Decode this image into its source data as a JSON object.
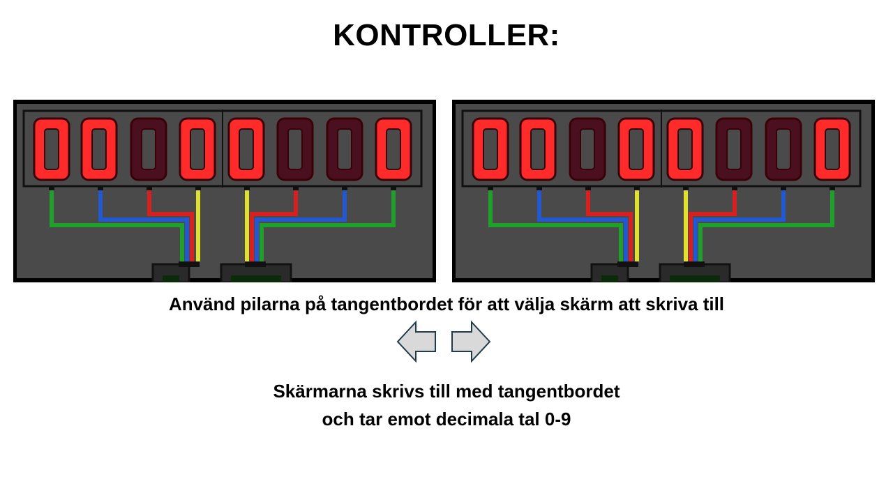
{
  "title": "KONTROLLER:",
  "displays": [
    {
      "digits": [
        "0",
        "0",
        "0",
        "0",
        "0",
        "0",
        "0",
        "0"
      ],
      "lit": [
        true,
        true,
        false,
        true,
        true,
        false,
        false,
        true
      ]
    },
    {
      "digits": [
        "0",
        "0",
        "0",
        "0",
        "0",
        "0",
        "0",
        "0"
      ],
      "lit": [
        true,
        true,
        false,
        true,
        true,
        false,
        false,
        true
      ]
    }
  ],
  "colors": {
    "lit_digit": "#ff2a2a",
    "dim_digit": "#4a1020",
    "panel_bg": "#4a4a4a",
    "wire_green": "#1fa02a",
    "wire_blue": "#2258d0",
    "wire_red": "#d82020",
    "wire_yellow": "#e0e030",
    "arrow_fill": "#d9d9d9",
    "arrow_stroke": "#1f3a4a"
  },
  "instructions": {
    "arrows": "Använd pilarna på tangentbordet för att välja skärm att skriva till",
    "keyboard_line1": "Skärmarna skrivs till med tangentbordet",
    "keyboard_line2": "och tar emot decimala tal 0-9"
  },
  "icons": [
    "arrow-left-icon",
    "arrow-right-icon"
  ]
}
